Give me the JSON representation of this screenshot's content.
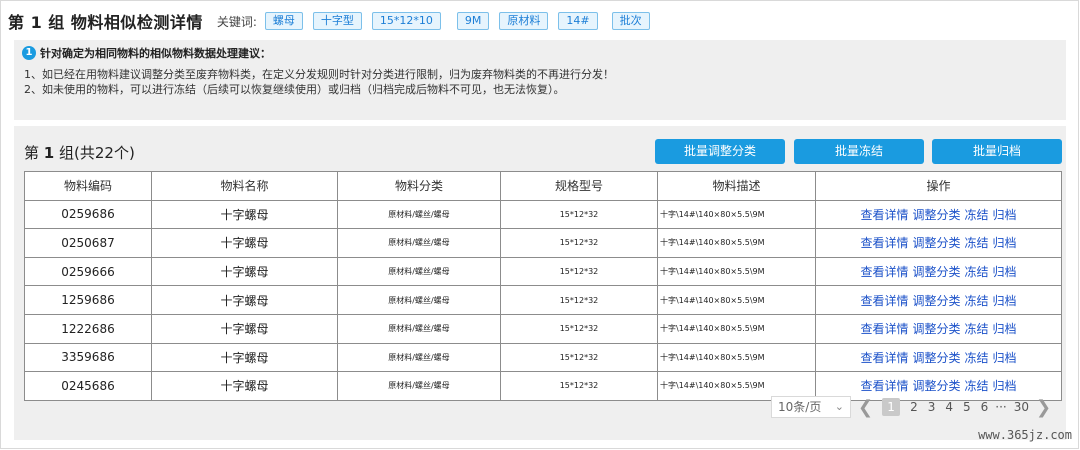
{
  "header": {
    "title": "第 1 组 物料相似检测详情",
    "keyword_label": "关键词:",
    "keywords": [
      "螺母",
      "十字型",
      "15*12*10",
      "9M",
      "原材料",
      "14#",
      "批次"
    ]
  },
  "advice": {
    "icon": "info-icon",
    "icon_text": "1",
    "title": "针对确定为相同物料的相似物料数据处理建议：",
    "lines": [
      "1、如已经在用物料建议调整分类至废弃物料类，在定义分发规则时针对分类进行限制，归为废弃物料类的不再进行分发！",
      "2、如未使用的物料，可以进行冻结（后续可以恢复继续使用）或归档（归档完成后物料不可见，也无法恢复）。"
    ]
  },
  "group": {
    "title_prefix": "第",
    "title_num": "1",
    "title_suffix": "组(共22个)",
    "buttons": {
      "batch_adjust": "批量调整分类",
      "batch_freeze": "批量冻结",
      "batch_archive": "批量归档"
    }
  },
  "table": {
    "headers": [
      "物料编码",
      "物料名称",
      "物料分类",
      "规格型号",
      "物料描述",
      "操作"
    ],
    "actions": {
      "view": "查看详情",
      "adjust": "调整分类",
      "freeze": "冻结",
      "archive": "归档"
    },
    "rows": [
      {
        "code": "0259686",
        "name": "十字螺母",
        "category": "原材料/螺丝/螺母",
        "spec": "15*12*32",
        "desc": "十字\\14#\\140×80×5.5\\9M"
      },
      {
        "code": "0250687",
        "name": "十字螺母",
        "category": "原材料/螺丝/螺母",
        "spec": "15*12*32",
        "desc": "十字\\14#\\140×80×5.5\\9M"
      },
      {
        "code": "0259666",
        "name": "十字螺母",
        "category": "原材料/螺丝/螺母",
        "spec": "15*12*32",
        "desc": "十字\\14#\\140×80×5.5\\9M"
      },
      {
        "code": "1259686",
        "name": "十字螺母",
        "category": "原材料/螺丝/螺母",
        "spec": "15*12*32",
        "desc": "十字\\14#\\140×80×5.5\\9M"
      },
      {
        "code": "1222686",
        "name": "十字螺母",
        "category": "原材料/螺丝/螺母",
        "spec": "15*12*32",
        "desc": "十字\\14#\\140×80×5.5\\9M"
      },
      {
        "code": "3359686",
        "name": "十字螺母",
        "category": "原材料/螺丝/螺母",
        "spec": "15*12*32",
        "desc": "十字\\14#\\140×80×5.5\\9M"
      },
      {
        "code": "0245686",
        "name": "十字螺母",
        "category": "原材料/螺丝/螺母",
        "spec": "15*12*32",
        "desc": "十字\\14#\\140×80×5.5\\9M"
      }
    ]
  },
  "pagination": {
    "per_page": "10条/页",
    "pages": [
      "1",
      "2",
      "3",
      "4",
      "5",
      "6",
      "···",
      "30"
    ],
    "current": "1"
  },
  "watermark": "www.365jz.com",
  "colors": {
    "accent": "#1a9be0",
    "link": "#1c52c9",
    "panel_bg": "#efefef"
  }
}
